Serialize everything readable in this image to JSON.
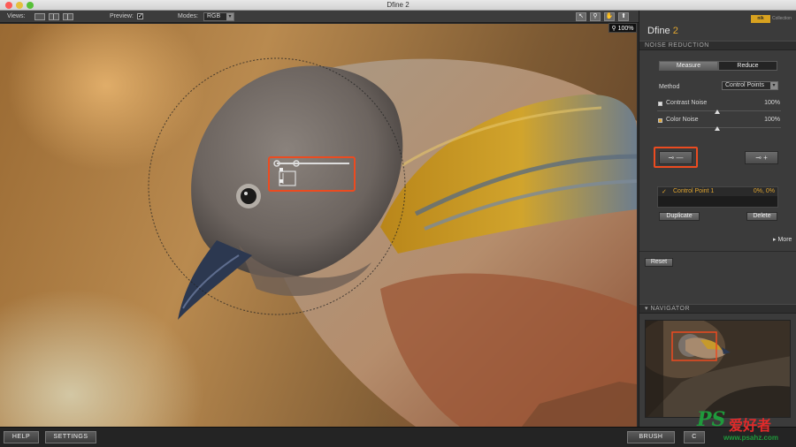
{
  "window": {
    "title": "Dfine 2"
  },
  "toolbar": {
    "views_label": "Views:",
    "preview_label": "Preview:",
    "preview_checked": true,
    "modes_label": "Modes:",
    "mode_value": "RGB",
    "zoom": "100%"
  },
  "panel": {
    "brand": "nik",
    "brand_sub": "Collection",
    "title_main": "Dfine",
    "title_version": "2",
    "section": "NOISE REDUCTION",
    "tabs": {
      "measure": "Measure",
      "reduce": "Reduce"
    },
    "method_label": "Method",
    "method_value": "Control Points",
    "contrast_noise_label": "Contrast Noise",
    "contrast_noise_value": "100%",
    "color_noise_label": "Color Noise",
    "color_noise_value": "100%",
    "control_point": {
      "name": "Control Point 1",
      "value": "0%, 0%"
    },
    "duplicate_label": "Duplicate",
    "delete_label": "Delete",
    "more_label": "More",
    "reset_label": "Reset",
    "navigator_label": "NAVIGATOR"
  },
  "bottom": {
    "help_label": "HELP",
    "settings_label": "SETTINGS",
    "brush_label": "BRUSH",
    "cancel_label": "C"
  },
  "watermark": {
    "ps": "PS",
    "cn": "爱好者",
    "url": "www.psahz.com"
  },
  "colors": {
    "accent": "#e0a530",
    "highlight": "#ec4b20",
    "panel_bg": "#3b3b3b"
  }
}
